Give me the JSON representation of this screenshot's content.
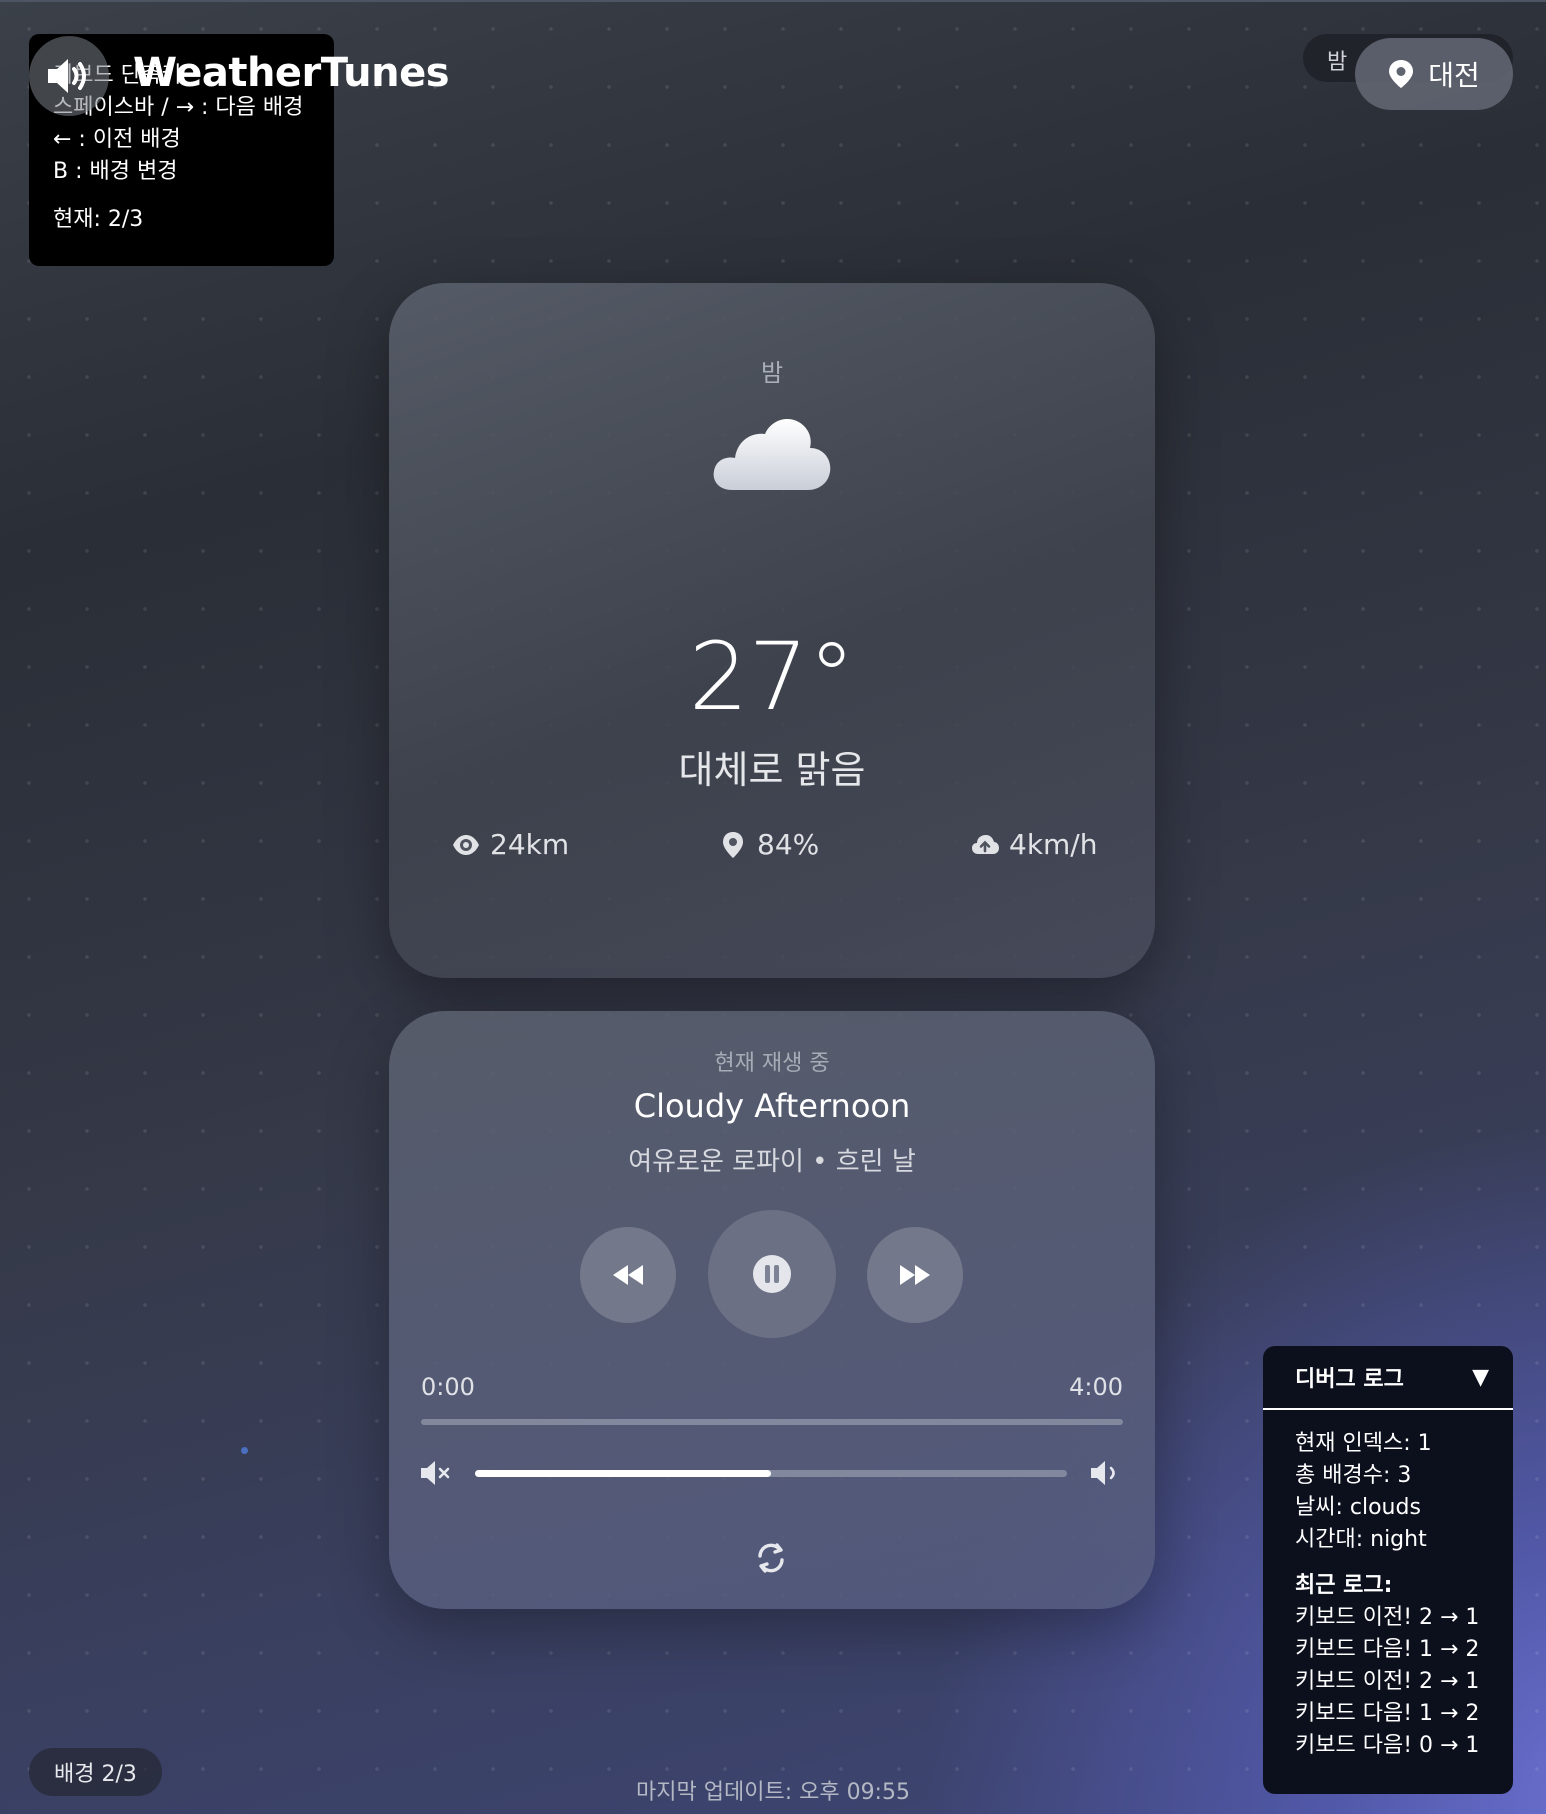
{
  "help": {
    "title": "키보드 단축키",
    "lines": [
      "스페이스바 / → : 다음 배경",
      "← : 이전 배경",
      "B : 배경 변경"
    ],
    "current": "현재: 2/3"
  },
  "app": {
    "title": "WeatherTunes"
  },
  "header": {
    "time_of_day": "밤",
    "location": "대전"
  },
  "weather": {
    "period": "밤",
    "icon": "cloud-icon",
    "temperature": "27°",
    "description": "대체로 맑음",
    "visibility": "24km",
    "humidity": "84%",
    "wind": "4km/h"
  },
  "player": {
    "label": "현재 재생 중",
    "track_title": "Cloudy Afternoon",
    "subtitle": "여유로운 로파이 • 흐린 날",
    "current_time": "0:00",
    "duration": "4:00",
    "progress_fraction": 0.0,
    "volume_fraction": 0.5
  },
  "debug": {
    "title": "디버그 로그",
    "toggle": "▼",
    "stats": [
      "현재 인덱스: 1",
      "총 배경수: 3",
      "날씨: clouds",
      "시간대: night"
    ],
    "log_title": "최근 로그:",
    "logs": [
      "키보드 이전! 2 → 1",
      "키보드 다음! 1 → 2",
      "키보드 이전! 2 → 1",
      "키보드 다음! 1 → 2",
      "키보드 다음! 0 → 1"
    ]
  },
  "footer": {
    "background_indicator": "배경 2/3",
    "last_updated": "마지막 업데이트: 오후 09:55"
  }
}
